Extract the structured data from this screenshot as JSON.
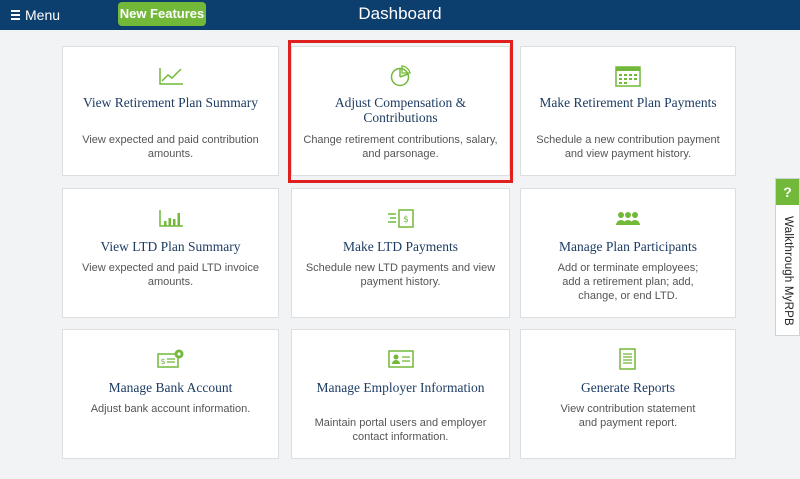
{
  "topbar": {
    "menu_label": "Menu",
    "new_features_label": "New Features",
    "title": "Dashboard"
  },
  "colors": {
    "navy": "#0d3f6e",
    "accent_green": "#72b93a",
    "highlight_red": "#e0201f"
  },
  "cards": [
    {
      "icon": "line-chart-icon",
      "title": "View Retirement Plan Summary",
      "desc": "View expected and paid contribution amounts."
    },
    {
      "icon": "pie-chart-icon",
      "title": "Adjust Compensation & Contributions",
      "desc": "Change retirement contributions, salary, and parsonage."
    },
    {
      "icon": "calendar-icon",
      "title": "Make Retirement Plan Payments",
      "desc": "Schedule a new contribution payment and view payment history."
    },
    {
      "icon": "bar-chart-icon",
      "title": "View LTD Plan Summary",
      "desc": "View expected and paid LTD invoice amounts."
    },
    {
      "icon": "bill-icon",
      "title": "Make LTD Payments",
      "desc": "Schedule new LTD payments and view payment history."
    },
    {
      "icon": "people-icon",
      "title": "Manage Plan Participants",
      "desc": "Add or terminate employees; add a retirement plan; add, change, or end LTD."
    },
    {
      "icon": "check-gear-icon",
      "title": "Manage Bank Account",
      "desc": "Adjust bank account information."
    },
    {
      "icon": "id-card-icon",
      "title": "Manage Employer Information",
      "desc": "Maintain portal users and employer contact information."
    },
    {
      "icon": "report-icon",
      "title": "Generate Reports",
      "desc": "View contribution statement and payment report."
    }
  ],
  "walkthrough": {
    "badge": "?",
    "label": "Walkthrough MyRPB"
  }
}
